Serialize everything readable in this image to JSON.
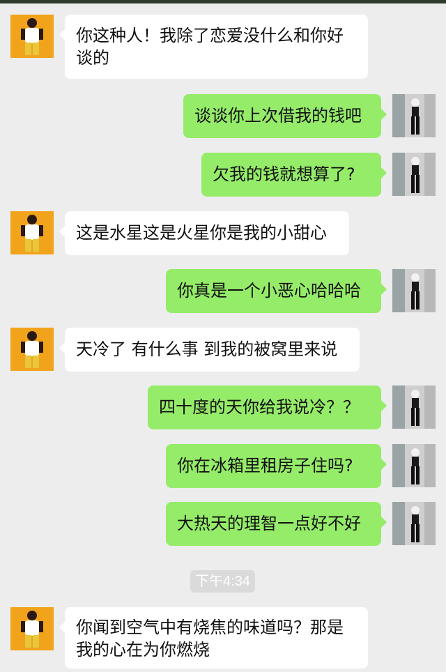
{
  "messages": [
    {
      "side": "left",
      "text": "你这种人！我除了恋爱没什么和你好谈的"
    },
    {
      "side": "right",
      "text": "谈谈你上次借我的钱吧"
    },
    {
      "side": "right",
      "text": "欠我的钱就想算了?"
    },
    {
      "side": "left",
      "text": "这是水星这是火星你是我的小甜心"
    },
    {
      "side": "right",
      "text": "你真是一个小恶心哈哈哈"
    },
    {
      "side": "left",
      "text": "天冷了 有什么事 到我的被窝里来说"
    },
    {
      "side": "right",
      "text": "四十度的天你给我说冷？？"
    },
    {
      "side": "right",
      "text": "你在冰箱里租房子住吗?"
    },
    {
      "side": "right",
      "text": "大热天的理智一点好不好"
    },
    {
      "side": "left",
      "text": "你闻到空气中有烧焦的味道吗？那是我的心在为你燃烧"
    }
  ],
  "timestamp": "下午4:34",
  "colors": {
    "background": "#ededed",
    "sent_bubble": "#95ec69",
    "received_bubble": "#ffffff",
    "avatar_left_bg": "#f2a31c"
  },
  "icons": {
    "avatar_left": "avatar-man-yellow-icon",
    "avatar_right": "avatar-woman-photo-icon"
  }
}
